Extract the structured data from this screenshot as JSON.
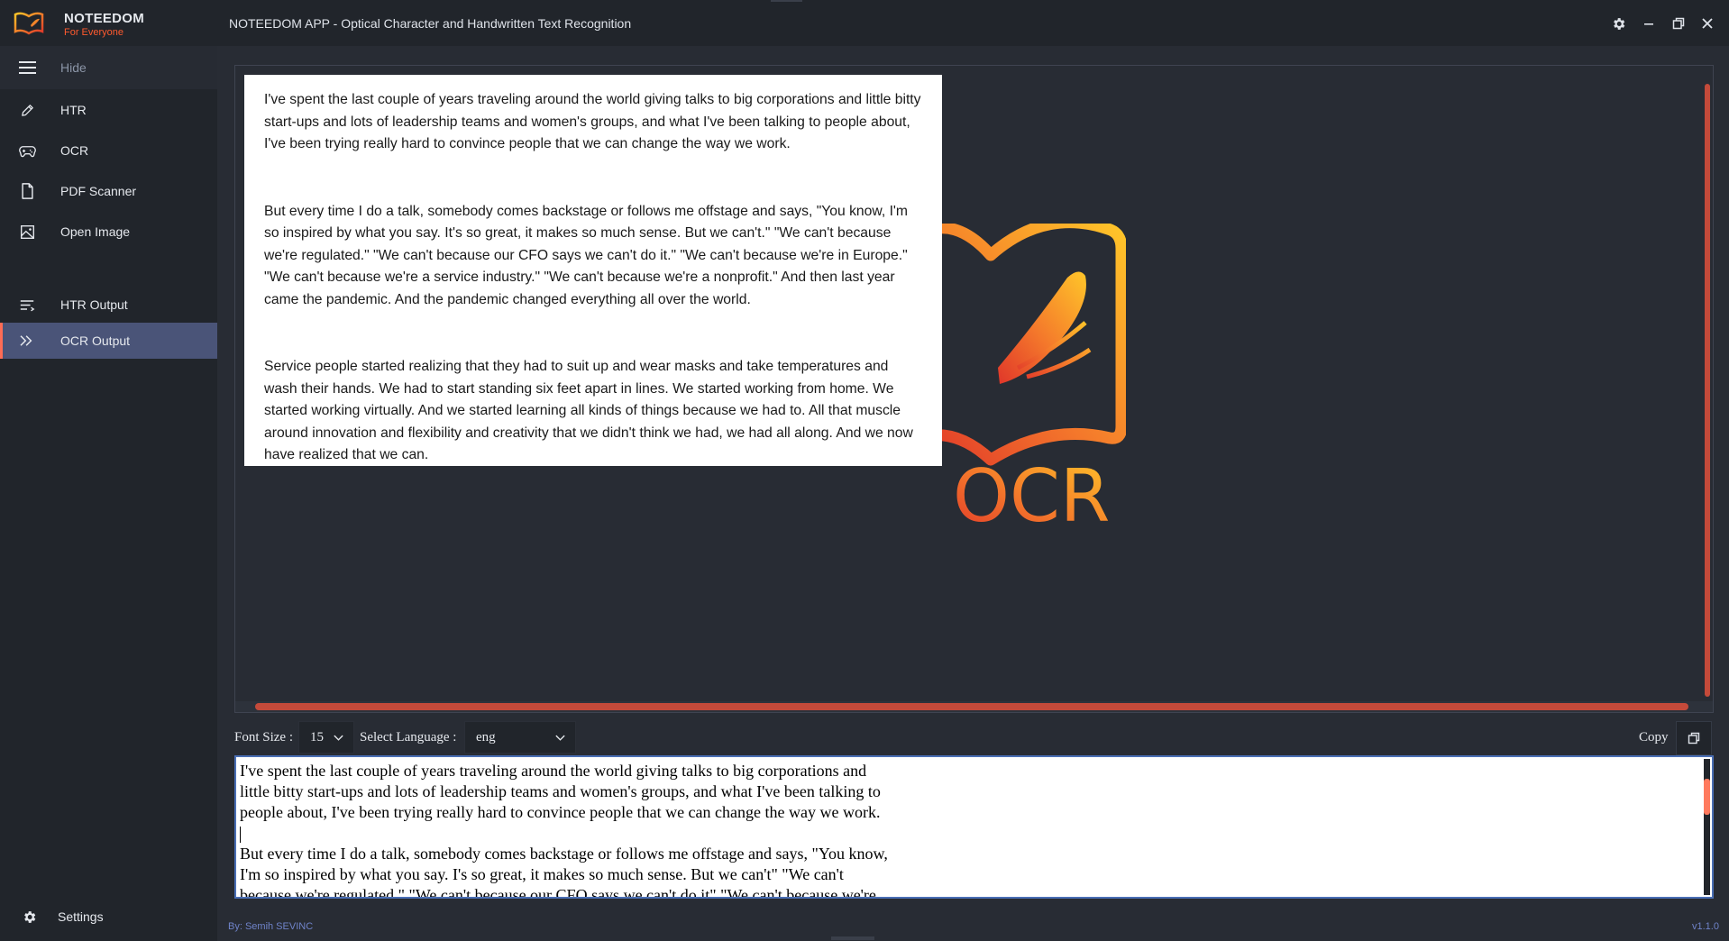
{
  "app": {
    "brand_name": "NOTEEDOM",
    "brand_tagline": "For Everyone",
    "window_title": "NOTEEDOM APP - Optical Character and Handwritten Text Recognition"
  },
  "window_controls": [
    "settings-icon",
    "minimize-icon",
    "restore-icon",
    "close-icon"
  ],
  "sidebar": {
    "toggle_label": "Hide",
    "items": [
      {
        "label": "HTR",
        "icon": "pen-icon"
      },
      {
        "label": "OCR",
        "icon": "gamepad-icon"
      },
      {
        "label": "PDF Scanner",
        "icon": "file-icon"
      },
      {
        "label": "Open Image",
        "icon": "image-icon"
      },
      {
        "label": "HTR Output",
        "icon": "text-lines-icon"
      },
      {
        "label": "OCR Output",
        "icon": "double-chevron-icon",
        "active": true
      }
    ],
    "settings_label": "Settings"
  },
  "image_viewer": {
    "paragraphs": [
      "I've spent the last couple of years traveling around the world giving talks to big corporations and little bitty start-ups and lots of leadership teams and women's groups, and what I've been talking to people about, I've been trying really hard to convince people that we can change the way we work.",
      "But every time I do a talk, somebody comes backstage or follows me offstage and says, \"You know, I'm so inspired by what you say. It's so great, it makes so much sense. But we can't.\" \"We can't because we're regulated.\" \"We can't because our CFO says we can't do it.\" \"We can't because we're in Europe.\" \"We can't because we're a service industry.\" \"We can't because we're a nonprofit.\" And then last year came the pandemic. And the pandemic changed everything all over the world.",
      "Service people started realizing that they had to suit up and wear masks and take temperatures and wash their hands. We had to start standing six feet apart in lines. We started working from home. We started working virtually. And we started learning all kinds of things because we had to. All that muscle around innovation and flexibility and creativity that we didn't think we had, we had all along. And we now have realized that we can."
    ],
    "logo_text": "OCR"
  },
  "controls": {
    "font_size_label": "Font Size :",
    "font_size_value": "15",
    "language_label": "Select Language :",
    "language_value": "eng",
    "copy_label": "Copy"
  },
  "output": {
    "lines": [
      "I've spent the last couple of years traveling around the world giving talks to big corporations and",
      "little bitty start-ups and lots of leadership teams and women's groups, and what I've been talking to",
      "people about, I've been trying really hard to convince people that we can change the way we work.",
      "",
      "But every time I do a talk, somebody comes backstage or follows me offstage and says, \"You know,",
      "I'm so inspired by what you say. I's so great, it makes so much sense. But we can't\" \"We can't",
      "because we're regulated.\" \"We can't because our CFO says we can't do it\" \"We can't because we're"
    ]
  },
  "footer": {
    "credit": "By: Semih SEVINC",
    "version": "v1.1.0"
  },
  "colors": {
    "accent": "#ff5a2e",
    "active_item": "#4a5478",
    "scrollbar": "#c44a3a",
    "logo_gradient": [
      "#ffc629",
      "#e0362a"
    ]
  }
}
